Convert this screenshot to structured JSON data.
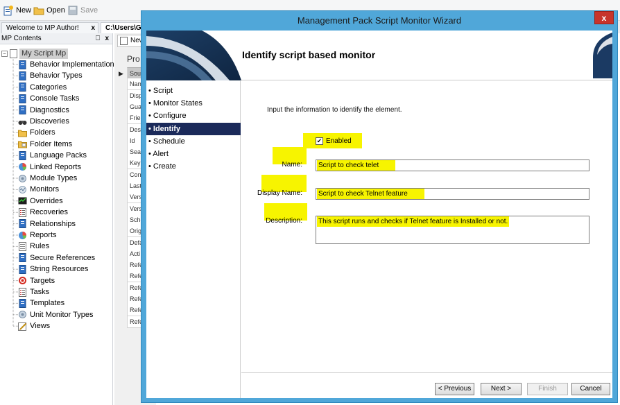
{
  "toolbar": {
    "new_label": "New",
    "open_label": "Open",
    "save_label": "Save"
  },
  "doc_tabs": [
    {
      "label": "Welcome to MP Author!",
      "close": "x"
    },
    {
      "label": "C:\\Users\\Ga"
    }
  ],
  "mp_panel": {
    "title": "MP Contents",
    "pin": "p",
    "close": "x",
    "root_label": "My Script Mp",
    "items": [
      {
        "label": "Behavior Implementation",
        "icon": "blue-doc-icon"
      },
      {
        "label": "Behavior Types",
        "icon": "blue-doc-icon"
      },
      {
        "label": "Categories",
        "icon": "blue-doc-icon"
      },
      {
        "label": "Console Tasks",
        "icon": "blue-doc-icon"
      },
      {
        "label": "Diagnostics",
        "icon": "blue-doc-icon"
      },
      {
        "label": "Discoveries",
        "icon": "binoculars-icon"
      },
      {
        "label": "Folders",
        "icon": "folder-icon"
      },
      {
        "label": "Folder Items",
        "icon": "folder-items-icon"
      },
      {
        "label": "Language Packs",
        "icon": "blue-doc-icon"
      },
      {
        "label": "Linked Reports",
        "icon": "pie-report-icon"
      },
      {
        "label": "Module Types",
        "icon": "module-icon"
      },
      {
        "label": "Monitors",
        "icon": "monitor-icon"
      },
      {
        "label": "Overrides",
        "icon": "override-icon"
      },
      {
        "label": "Recoveries",
        "icon": "list-icon"
      },
      {
        "label": "Relationships",
        "icon": "blue-doc-icon"
      },
      {
        "label": "Reports",
        "icon": "pie-report-icon"
      },
      {
        "label": "Rules",
        "icon": "rules-icon"
      },
      {
        "label": "Secure References",
        "icon": "blue-doc-icon"
      },
      {
        "label": "String Resources",
        "icon": "blue-doc-icon"
      },
      {
        "label": "Targets",
        "icon": "target-icon"
      },
      {
        "label": "Tasks",
        "icon": "list-icon"
      },
      {
        "label": "Templates",
        "icon": "blue-doc-icon"
      },
      {
        "label": "Unit Monitor Types",
        "icon": "module-icon"
      },
      {
        "label": "Views",
        "icon": "view-icon"
      }
    ]
  },
  "mid_panel": {
    "tab_label": "New",
    "title": "Pro",
    "rows": [
      "Sou",
      "Nam",
      "Disp",
      "Gua",
      "Frie",
      "Des",
      "Id",
      "Sea",
      "Key",
      "Con",
      "Last",
      "Vers",
      "Vers",
      "Sche",
      "Orig",
      "Defa",
      "Acti",
      "Refe",
      "Refe",
      "Refe",
      "Refe",
      "Refe",
      "Refe"
    ]
  },
  "wizard": {
    "title": "Management Pack Script Monitor Wizard",
    "close_label": "x",
    "heading": "Identify script based monitor",
    "nav": [
      {
        "label": "• Script",
        "active": false
      },
      {
        "label": "• Monitor States",
        "active": false
      },
      {
        "label": "• Configure",
        "active": false
      },
      {
        "label": "• Identify",
        "active": true
      },
      {
        "label": "• Schedule",
        "active": false
      },
      {
        "label": "• Alert",
        "active": false
      },
      {
        "label": "• Create",
        "active": false
      }
    ],
    "hint": "Input the information to identify the element.",
    "enabled_label": "Enabled",
    "enabled_checked": true,
    "name_label": "Name:",
    "name_value": "Script to check telet",
    "display_name_label": "Display Name:",
    "display_name_value": "Script to check Telnet feature",
    "description_label": "Description:",
    "description_value": "This script runs and checks if Telnet feature is Installed or not.",
    "buttons": {
      "previous": "< Previous",
      "next": "Next >",
      "finish": "Finish",
      "cancel": "Cancel"
    },
    "highlight_color": "#f7f400",
    "active_nav_color": "#1b2a5a"
  }
}
